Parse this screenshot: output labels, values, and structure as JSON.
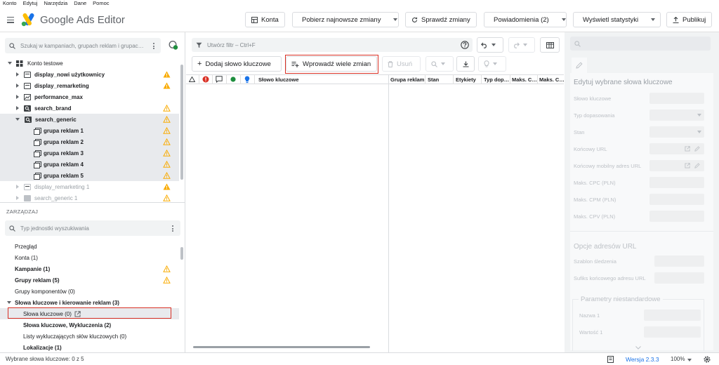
{
  "menu": [
    "Konto",
    "Edytuj",
    "Narzędzia",
    "Dane",
    "Pomoc"
  ],
  "app_title": "Google Ads Editor",
  "header": {
    "accounts": "Konta",
    "download": "Pobierz najnowsze zmiany",
    "check": "Sprawdź zmiany",
    "notifications": "Powiadomienia (2)",
    "stats": "Wyświetl statystyki",
    "publish": "Publikuj"
  },
  "tree": {
    "search_placeholder": "Szukaj w kampaniach, grupach reklam i grupac…",
    "root": "Konto testowe",
    "campaigns": [
      {
        "name": "display_nowi użytkownicy",
        "warn": "yellow"
      },
      {
        "name": "display_remarketing",
        "warn": "yellow"
      },
      {
        "name": "performance_max",
        "warn": "none"
      },
      {
        "name": "search_brand",
        "warn": "outline"
      },
      {
        "name": "search_generic",
        "warn": "outline"
      }
    ],
    "ad_groups": [
      "grupa reklam 1",
      "grupa reklam 2",
      "grupa reklam 3",
      "grupa reklam 4",
      "grupa reklam 5"
    ],
    "dim_campaigns": [
      {
        "name": "display_remarketing 1",
        "warn": "yellow"
      },
      {
        "name": "search_generic 1",
        "warn": "outline"
      }
    ]
  },
  "manage": {
    "title": "ZARZĄDZAJ",
    "search_placeholder": "Typ jednostki wyszukiwania",
    "items": {
      "overview": "Przegląd",
      "accounts": "Konta (1)",
      "campaigns": "Kampanie (1)",
      "ad_groups": "Grupy reklam (5)",
      "asset_groups": "Grupy komponentów (0)",
      "keywords_section": "Słowa kluczowe i kierowanie reklam (3)",
      "keywords": "Słowa kluczowe (0)",
      "keywords_neg": "Słowa kluczowe, Wykluczenia (2)",
      "neg_lists": "Listy wykluczających słów kluczowych (0)",
      "locations": "Lokalizacje (1)"
    }
  },
  "toolbar": {
    "filter_placeholder": "Utwórz filtr – Ctrl+F",
    "add_keyword": "Dodaj słowo kluczowe",
    "bulk_changes": "Wprowadź wiele zmian",
    "delete": "Usuń"
  },
  "grid": {
    "col_keyword": "Słowo kluczowe",
    "col_adgroup": "Grupa reklam",
    "col_status": "Stan",
    "col_labels": "Etykiety",
    "col_match": "Typ dop…",
    "col_maxc": "Maks. C…",
    "col_maxc2": "Maks. C…"
  },
  "edit_panel": {
    "title": "Edytuj wybrane słowa kluczowe",
    "fields": [
      "Słowo kluczowe",
      "Typ dopasowania",
      "Stan",
      "Końcowy URL",
      "Końcowy mobilny adres URL",
      "Maks. CPC (PLN)",
      "Maks. CPM (PLN)",
      "Maks. CPV (PLN)"
    ],
    "url_options_title": "Opcje adresów URL",
    "url_fields": [
      "Szablon śledzenia",
      "Sufiks końcowego adresu URL"
    ],
    "custom_params_title": "Parametry niestandardowe",
    "custom_fields": [
      "Nazwa 1",
      "Wartość 1"
    ]
  },
  "status_bar": {
    "selected": "Wybrane słowa kluczowe: 0 z 5",
    "version": "Wersja 2.3.3",
    "zoom": "100%"
  },
  "colors": {
    "warn_yellow": "#f9ab00",
    "accent_blue": "#1a73e8",
    "error_red": "#d93025",
    "green": "#1e8e3e"
  }
}
